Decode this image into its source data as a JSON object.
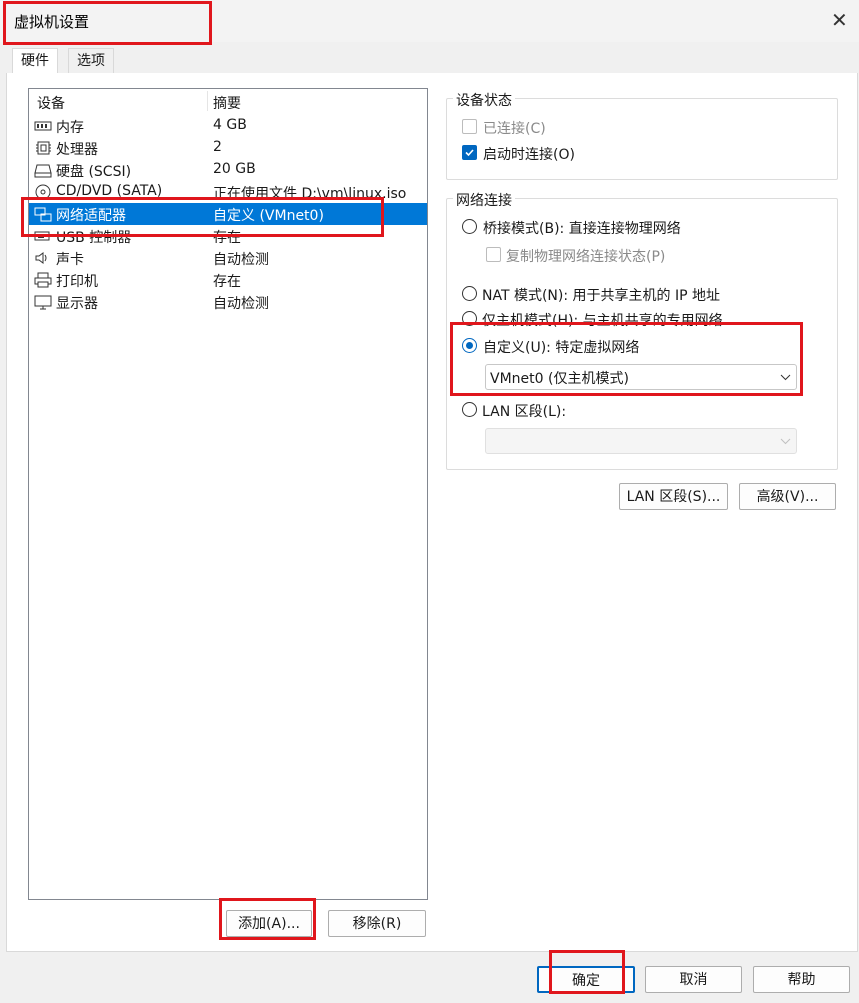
{
  "window": {
    "title": "虚拟机设置"
  },
  "tabs": [
    {
      "label": "硬件"
    },
    {
      "label": "选项"
    }
  ],
  "device_list": {
    "headers": {
      "device": "设备",
      "summary": "摘要"
    },
    "rows": [
      {
        "name": "内存",
        "summary": "4 GB",
        "icon": "memory-icon"
      },
      {
        "name": "处理器",
        "summary": "2",
        "icon": "cpu-icon"
      },
      {
        "name": "硬盘 (SCSI)",
        "summary": "20 GB",
        "icon": "harddisk-icon"
      },
      {
        "name": "CD/DVD (SATA)",
        "summary": "正在使用文件 D:\\vm\\linux.iso",
        "icon": "cdrom-icon"
      },
      {
        "name": "网络适配器",
        "summary": "自定义 (VMnet0)",
        "icon": "network-adapter-icon",
        "selected": true
      },
      {
        "name": "USB 控制器",
        "summary": "存在",
        "icon": "usb-icon"
      },
      {
        "name": "声卡",
        "summary": "自动检测",
        "icon": "sound-icon"
      },
      {
        "name": "打印机",
        "summary": "存在",
        "icon": "printer-icon"
      },
      {
        "name": "显示器",
        "summary": "自动检测",
        "icon": "display-icon"
      }
    ]
  },
  "list_buttons": {
    "add": "添加(A)...",
    "remove": "移除(R)"
  },
  "device_status": {
    "title": "设备状态",
    "connected": "已连接(C)",
    "connect_at_power_on": "启动时连接(O)"
  },
  "network": {
    "title": "网络连接",
    "bridged": "桥接模式(B): 直接连接物理网络",
    "replicate": "复制物理网络连接状态(P)",
    "nat": "NAT 模式(N): 用于共享主机的 IP 地址",
    "hostonly": "仅主机模式(H): 与主机共享的专用网络",
    "custom": "自定义(U): 特定虚拟网络",
    "custom_selected": "VMnet0 (仅主机模式)",
    "lan": "LAN 区段(L):",
    "selected_mode": "custom"
  },
  "network_buttons": {
    "lan_segments": "LAN 区段(S)...",
    "advanced": "高级(V)..."
  },
  "footer": {
    "ok": "确定",
    "cancel": "取消",
    "help": "帮助"
  },
  "colors": {
    "accent": "#0078d7",
    "annotation": "#e0161c"
  }
}
